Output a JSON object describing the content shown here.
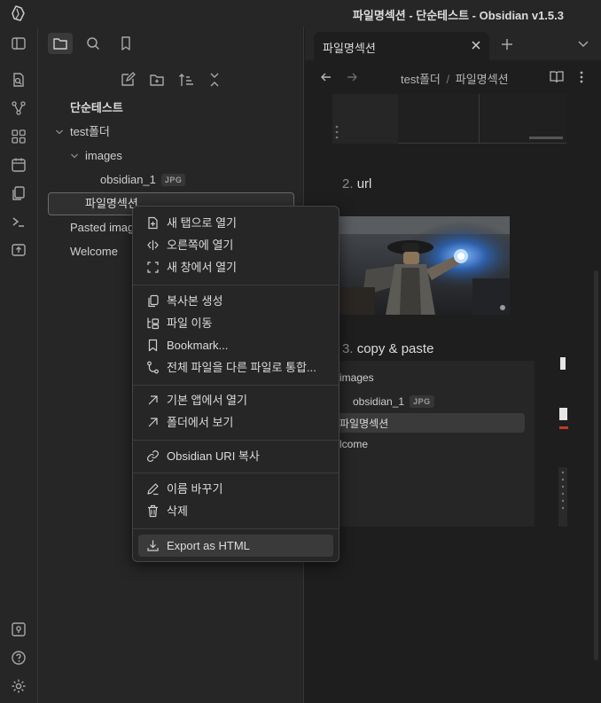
{
  "window": {
    "title": "파일명섹션 - 단순테스트 - Obsidian v1.5.3"
  },
  "sidebar": {
    "vault_name": "단순테스트",
    "tree": [
      {
        "label": "test폴더",
        "type": "folder"
      },
      {
        "label": "images",
        "type": "folder"
      },
      {
        "label": "obsidian_1",
        "badge": "JPG",
        "type": "file"
      },
      {
        "label": "파일명섹션",
        "type": "file"
      },
      {
        "label": "Pasted image",
        "type": "file"
      },
      {
        "label": "Welcome",
        "type": "file"
      }
    ]
  },
  "tab": {
    "label": "파일명섹션"
  },
  "breadcrumb": {
    "folder": "test폴더",
    "sep": "/",
    "file": "파일명섹션"
  },
  "doc": {
    "h2": {
      "num": "2.",
      "text": "url"
    },
    "h3": {
      "num": "3.",
      "text": "copy & paste"
    },
    "embedded": {
      "items": [
        {
          "label": "images"
        },
        {
          "label": "obsidian_1",
          "badge": "JPG"
        },
        {
          "label": "파일명섹션"
        },
        {
          "label": "lcome"
        }
      ]
    }
  },
  "context_menu": {
    "items": [
      {
        "label": "새 탭으로 열기",
        "icon": "new-tab-icon"
      },
      {
        "label": "오른쪽에 열기",
        "icon": "split-right-icon"
      },
      {
        "label": "새 창에서 열기",
        "icon": "new-window-icon"
      },
      {
        "label": "복사본 생성",
        "icon": "copy-icon"
      },
      {
        "label": "파일 이동",
        "icon": "move-folder-icon"
      },
      {
        "label": "Bookmark...",
        "icon": "bookmark-icon"
      },
      {
        "label": "전체 파일을 다른 파일로 통합...",
        "icon": "merge-icon"
      },
      {
        "label": "기본 앱에서 열기",
        "icon": "external-link-icon"
      },
      {
        "label": "폴더에서 보기",
        "icon": "reveal-folder-icon"
      },
      {
        "label": "Obsidian URI 복사",
        "icon": "link-icon"
      },
      {
        "label": "이름 바꾸기",
        "icon": "edit-icon"
      },
      {
        "label": "삭제",
        "icon": "trash-icon"
      },
      {
        "label": "Export as HTML",
        "icon": "download-icon"
      }
    ]
  },
  "colors": {
    "background": "#1e1e1e",
    "panel": "#262626",
    "accent_red": "#c0392b"
  }
}
